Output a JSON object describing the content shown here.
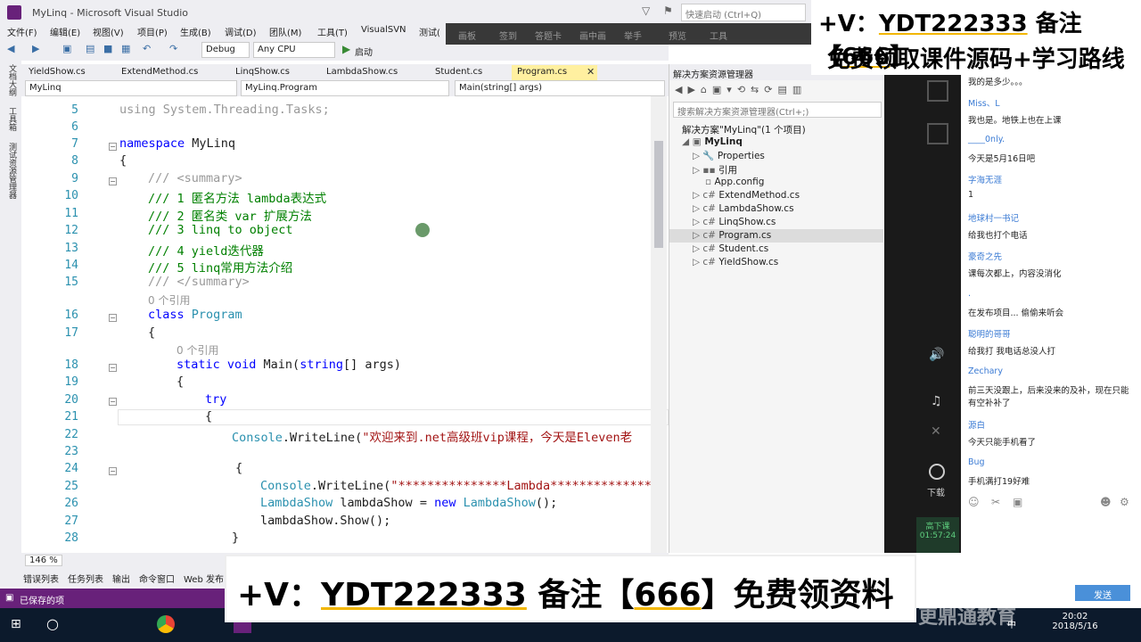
{
  "window": {
    "title": "MyLinq - Microsoft Visual Studio",
    "quick_launch": "快速启动 (Ctrl+Q)"
  },
  "menu": [
    "文件(F)",
    "编辑(E)",
    "视图(V)",
    "项目(P)",
    "生成(B)",
    "调试(D)",
    "团队(M)",
    "工具(T)",
    "VisualSVN",
    "测试("
  ],
  "toolbar": {
    "config": "Debug",
    "platform": "Any CPU",
    "start": "启动"
  },
  "overlay": [
    "画板",
    "签到",
    "答题卡",
    "画中画",
    "举手",
    "预览",
    "工具"
  ],
  "side_labels": [
    "文档大纲",
    "工具箱",
    "测试资源管理器"
  ],
  "tabs": [
    "YieldShow.cs",
    "ExtendMethod.cs",
    "LinqShow.cs",
    "LambdaShow.cs",
    "Student.cs",
    "Program.cs"
  ],
  "nav": {
    "project": "MyLinq",
    "class": "MyLinq.Program",
    "member": "Main(string[] args)"
  },
  "code": {
    "l5": "using System.Threading.Tasks;",
    "l7a": "namespace",
    "l7b": " MyLinq",
    "l8": "{",
    "l9": "/// <summary>",
    "l10": "/// 1 匿名方法 lambda表达式",
    "l11": "/// 2 匿名类 var 扩展方法",
    "l12": "/// 3 linq to object",
    "l13": "/// 4 yield迭代器",
    "l14": "/// 5 linq常用方法介绍",
    "l15": "/// </summary>",
    "ref1": "0 个引用",
    "l16a": "class",
    "l16b": " Program",
    "l17": "{",
    "ref2": "0 个引用",
    "l18a": "static void",
    "l18b": " Main(",
    "l18c": "string",
    "l18d": "[] args)",
    "l19": "{",
    "l20": "try",
    "l21": "{",
    "l22a": "Console",
    "l22b": ".WriteLine(",
    "l22c": "\"欢迎来到.net高级班vip课程，今天是Eleven老",
    "l24": "{",
    "l25a": "Console",
    "l25b": ".WriteLine(",
    "l25c": "\"***************Lambda****************",
    "l26a": "LambdaShow",
    "l26b": " lambdaShow = ",
    "l26c": "new",
    "l26d": " LambdaShow",
    "l26e": "();",
    "l27": "lambdaShow.Show();",
    "l28": "}"
  },
  "line_numbers": [
    "5",
    "6",
    "7",
    "8",
    "9",
    "10",
    "11",
    "12",
    "13",
    "14",
    "15",
    "16",
    "17",
    "18",
    "19",
    "20",
    "21",
    "22",
    "23",
    "24",
    "25",
    "26",
    "27",
    "28"
  ],
  "zoom": "146 %",
  "bottom_tabs": [
    "错误列表",
    "任务列表",
    "输出",
    "命令窗口",
    "Web 发布"
  ],
  "status": "已保存的项",
  "solution_explorer": {
    "title": "解决方案资源管理器",
    "search": "搜索解决方案资源管理器(Ctrl+;)",
    "solution": "解决方案\"MyLinq\"(1 个项目)",
    "project": "MyLinq",
    "items": [
      "Properties",
      "引用",
      "App.config",
      "ExtendMethod.cs",
      "LambdaShow.cs",
      "LinqShow.cs",
      "Program.cs",
      "Student.cs",
      "YieldShow.cs"
    ]
  },
  "live": {
    "leave": "下课",
    "leave_time": "高下课",
    "timer": "01:57:24",
    "download": "下载"
  },
  "chat": [
    {
      "name": "",
      "msg": "我的是多少。。。"
    },
    {
      "name": "Miss、L",
      "msg": "我也是。地铁上也在上课"
    },
    {
      "name": "____0nly.",
      "msg": "今天是5月16日吧"
    },
    {
      "name": "字海无涯",
      "msg": "1"
    },
    {
      "name": "地球村一书记",
      "msg": "给我也打个电话"
    },
    {
      "name": "豪奇之先",
      "msg": "课每次都上，内容没消化"
    },
    {
      "name": ".",
      "msg": "在发布项目... 偷偷来听会"
    },
    {
      "name": "聪明的哥哥",
      "msg": "给我打 我电话总没人打"
    },
    {
      "name": "Zechary",
      "msg": "前三天没跟上，后来没来的及补，现在只能有空补补了"
    },
    {
      "name": "源白",
      "msg": "今天只能手机看了"
    },
    {
      "name": "Bug",
      "msg": "手机满打19好难"
    }
  ],
  "chat_send": "发送",
  "promo_top": {
    "line1a": "+V：",
    "line1b": "YDT222333",
    "line1c": " 备注【",
    "line1d": "666",
    "line1e": "】",
    "line2": "免费领取课件源码+学习路线"
  },
  "promo_bottom": {
    "a": "+V：",
    "b": "YDT222333",
    "c": " 备注【",
    "d": "666",
    "e": "】免费领资料"
  },
  "taskbar": {
    "time": "20:02",
    "date": "2018/5/16",
    "ime": "中"
  },
  "watermark": "更鼎通教育"
}
